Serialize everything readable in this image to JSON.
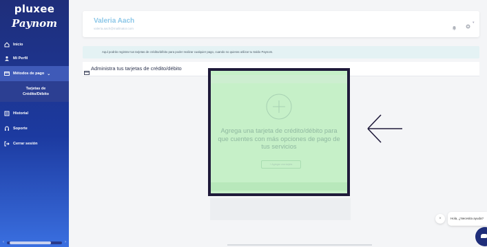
{
  "brand": {
    "name_top": "pluxee",
    "name_bottom": "Paynom"
  },
  "sidebar": {
    "items": [
      {
        "label": "Inicio",
        "icon": "home-icon"
      },
      {
        "label": "Mi Perfil",
        "icon": "user-icon"
      },
      {
        "label": "Métodos de pago",
        "icon": "card-icon",
        "active": true,
        "chevron": "⌄"
      },
      {
        "label": "Historial",
        "icon": "history-icon"
      },
      {
        "label": "Soporte",
        "icon": "support-icon"
      },
      {
        "label": "Cerrar sesión",
        "icon": "logout-icon"
      }
    ],
    "sub_item": "Tarjetas de Crédito/Débito"
  },
  "header": {
    "user_name": "Valeria Aach",
    "user_email": "valeria.aach@mailinator.com"
  },
  "info": {
    "text": "Aquí podrás registrar tus tarjetas de crédito/débito para poder realizar cualquier pago, cuando no quieras utilizar tu Saldo Paynom."
  },
  "section": {
    "title": "Administra tus tarjetas de crédito/débito"
  },
  "empty_state": {
    "message": "Agrega una tarjeta de crédito/débito para que cuentes con más opciones de pago de tus servicios",
    "button": "+ Agregar una tarjeta"
  },
  "chat": {
    "close": "×",
    "greeting": "Hola, ¿Necesita ayuda?"
  },
  "colors": {
    "sidebar_dark": "#1f2e7a",
    "highlight_green": "#c6f0c8",
    "highlight_border": "#1f1a3a",
    "user_name": "#8cc7e8"
  }
}
